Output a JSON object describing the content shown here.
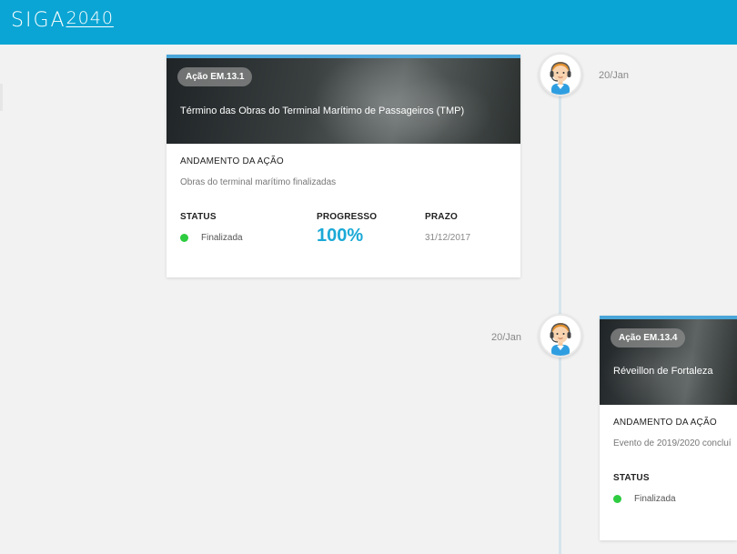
{
  "header": {
    "logo_text": "SIGA",
    "logo_number": "2040"
  },
  "colors": {
    "header_bg": "#0aa5d4",
    "accent": "#1ba9d6",
    "status_ok": "#2ecc40"
  },
  "timeline": [
    {
      "date": "20/Jan",
      "avatar_icon": "support-agent-icon",
      "badge": "Ação EM.13.1",
      "title": "Término das Obras do Terminal Marítimo de Passageiros (TMP)",
      "section_title": "ANDAMENTO DA AÇÃO",
      "description": "Obras do terminal marítimo finalizadas",
      "status_label": "STATUS",
      "status_value": "Finalizada",
      "progress_label": "PROGRESSO",
      "progress_value": "100%",
      "deadline_label": "PRAZO",
      "deadline_value": "31/12/2017"
    },
    {
      "date": "20/Jan",
      "avatar_icon": "support-agent-icon",
      "badge": "Ação EM.13.4",
      "title": "Réveillon de Fortaleza",
      "section_title": "ANDAMENTO DA AÇÃO",
      "description": "Evento de 2019/2020 concluí",
      "status_label": "STATUS",
      "status_value": "Finalizada"
    }
  ]
}
